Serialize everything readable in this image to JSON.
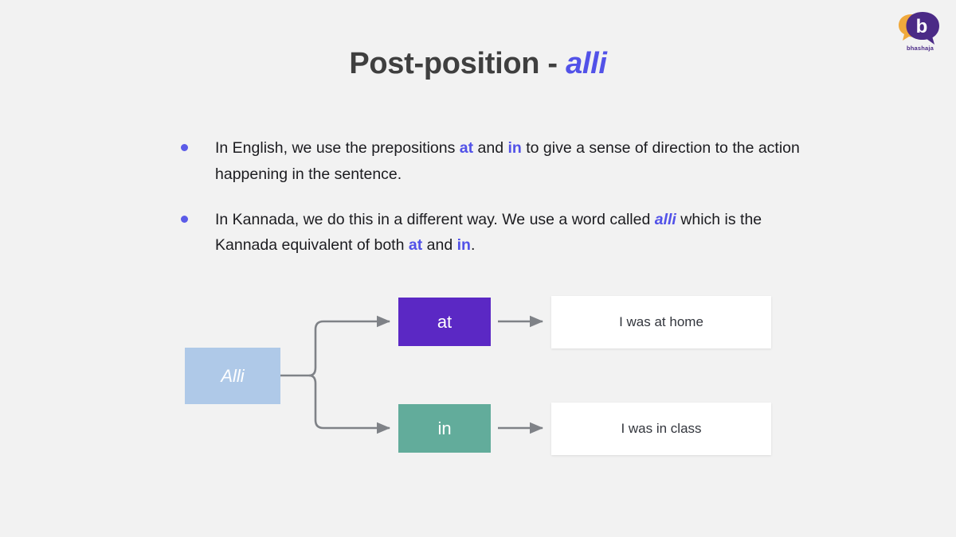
{
  "slide": {
    "background_color": "#f2f2f2",
    "title": {
      "main": "Post-position - ",
      "accent": "alli"
    }
  },
  "logo": {
    "name": "bhashaja-logo",
    "wordmark": "bhashaja",
    "letter": "b",
    "bubble_color": "#4b2a86",
    "accent_color": "#f0a93c",
    "text_color": "#4b2a86"
  },
  "bullets": [
    {
      "id": "bullet-english",
      "segments": [
        {
          "text": "In English, we use the prepositions ",
          "style": "plain"
        },
        {
          "text": "at",
          "style": "keyword"
        },
        {
          "text": " and ",
          "style": "plain"
        },
        {
          "text": "in",
          "style": "keyword"
        },
        {
          "text": " to give a sense of direction to the action happening in the sentence.",
          "style": "plain"
        }
      ]
    },
    {
      "id": "bullet-kannada",
      "segments": [
        {
          "text": "In Kannada, we do this in a different way. We use a word called ",
          "style": "plain"
        },
        {
          "text": "alli",
          "style": "keyword-italic"
        },
        {
          "text": " which is the Kannada equivalent of both ",
          "style": "plain"
        },
        {
          "text": "at",
          "style": "keyword"
        },
        {
          "text": " and ",
          "style": "plain"
        },
        {
          "text": "in",
          "style": "keyword"
        },
        {
          "text": ".",
          "style": "plain"
        }
      ]
    }
  ],
  "diagram": {
    "root": {
      "label": "Alli",
      "color": "#afc9e8",
      "text_color": "#ffffff"
    },
    "branches": [
      {
        "id": "branch-at",
        "label": "at",
        "color": "#5b28c4",
        "text_color": "#ffffff",
        "example": "I was at home",
        "example_bg": "#ffffff",
        "example_text_color": "#33363d"
      },
      {
        "id": "branch-in",
        "label": "in",
        "color": "#62ac9b",
        "text_color": "#ffffff",
        "example": "I was in class",
        "example_bg": "#ffffff",
        "example_text_color": "#33363d"
      }
    ],
    "connector_color": "#7f8287"
  },
  "colors": {
    "accent_blue": "#5252e8",
    "bullet_dot": "#5b5be8",
    "title_text": "#3f3f3f",
    "body_text": "#1c1c20"
  }
}
